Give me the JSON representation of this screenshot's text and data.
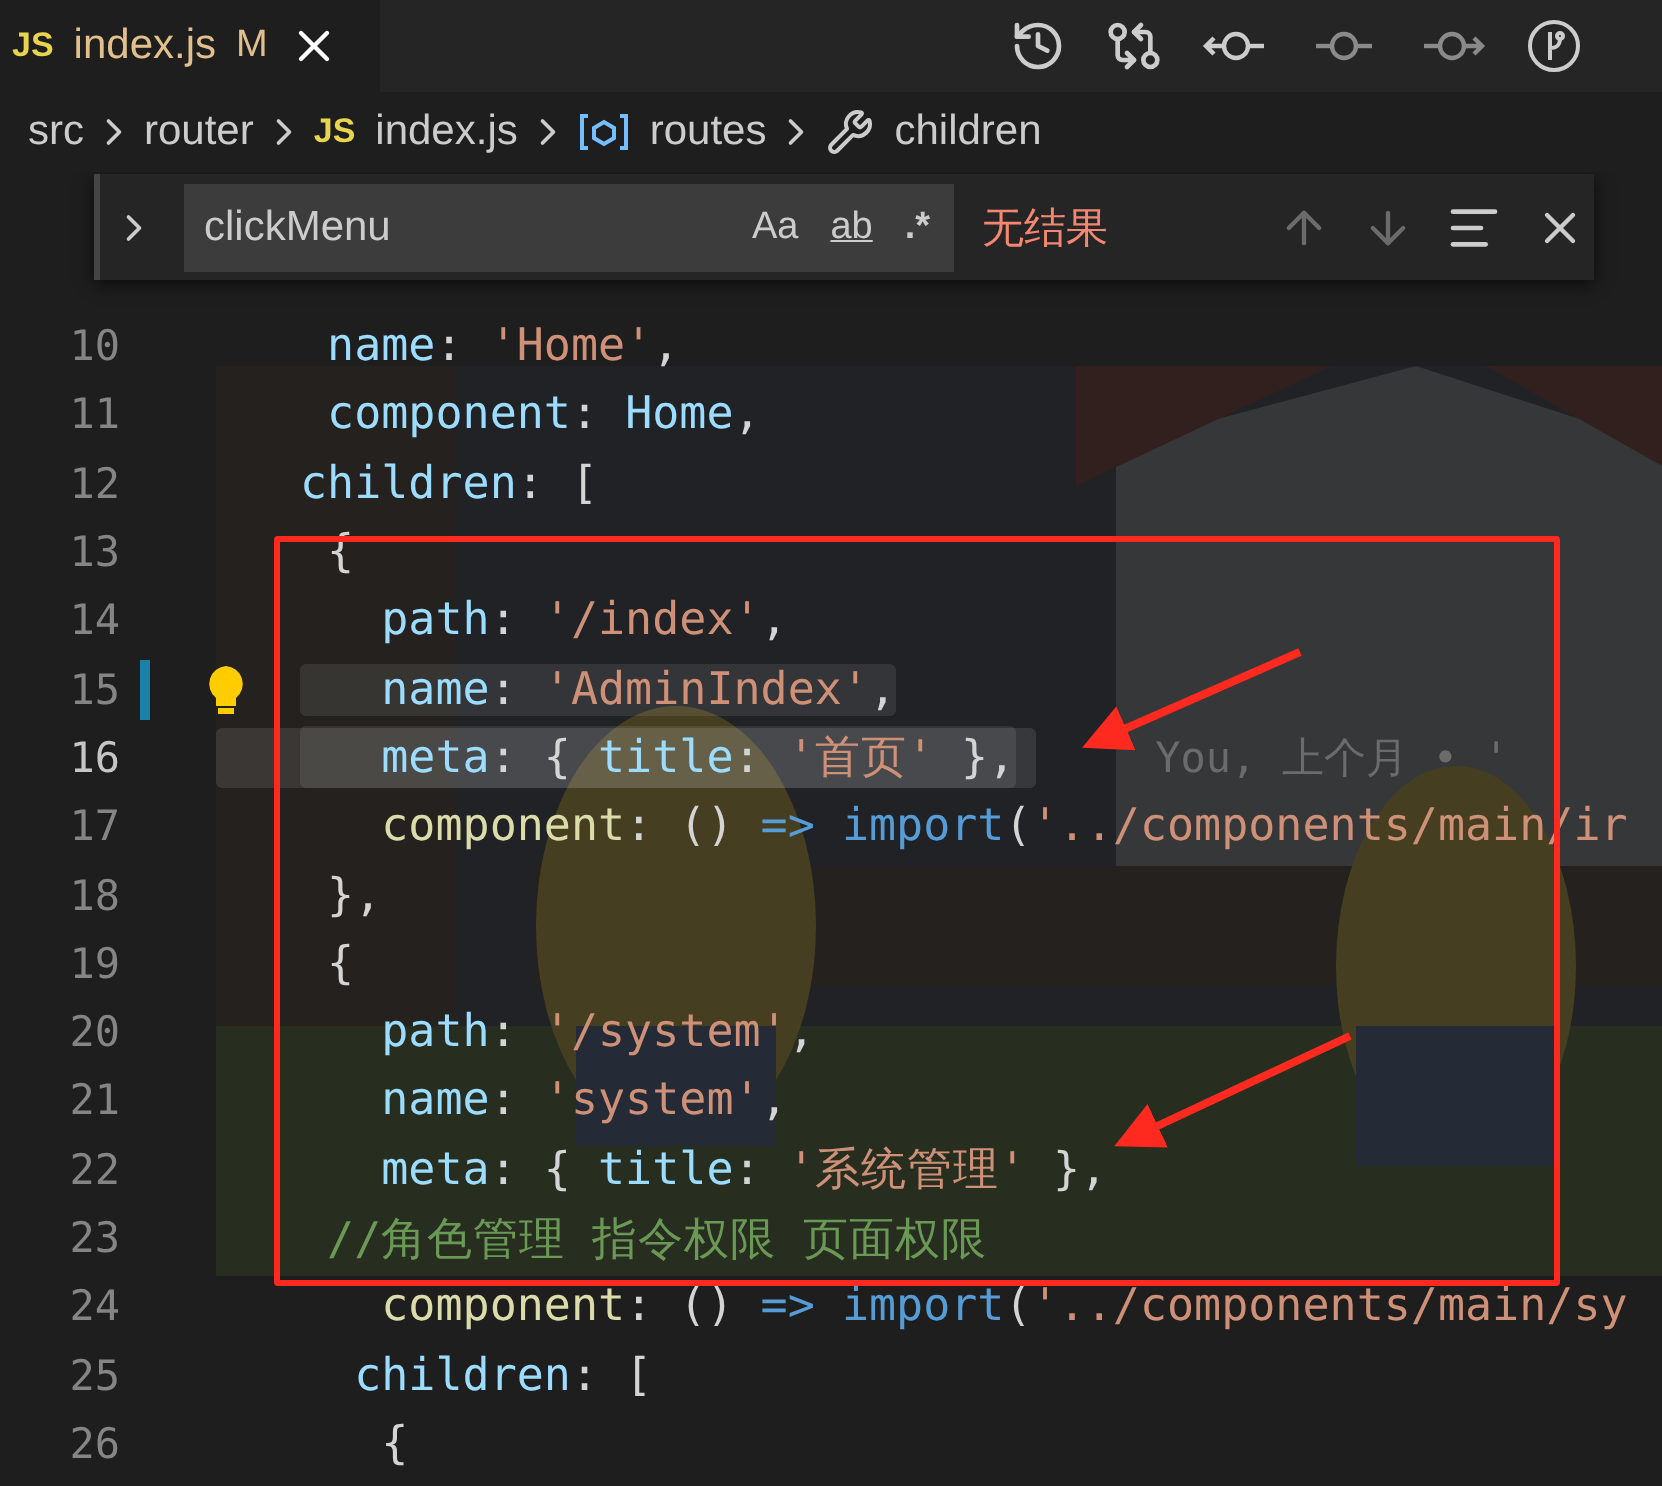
{
  "tabs": [
    {
      "icon_label": "JS",
      "name": "index.js",
      "status": "M",
      "selected": true
    }
  ],
  "breadcrumb": [
    {
      "label": "src",
      "kind": "folder"
    },
    {
      "label": "router",
      "kind": "folder"
    },
    {
      "label": "index.js",
      "kind": "file",
      "icon_label": "JS"
    },
    {
      "label": "routes",
      "kind": "symbol"
    },
    {
      "label": "children",
      "kind": "property"
    }
  ],
  "find": {
    "expanded": false,
    "value": "clickMenu",
    "options": [
      {
        "label": "Aa",
        "kind": "case"
      },
      {
        "label": "ab",
        "kind": "word"
      },
      {
        "label": ".*",
        "kind": "regex"
      }
    ],
    "status": "无结果",
    "nav": [
      {
        "kind": "previous",
        "disabled": true
      },
      {
        "kind": "next",
        "disabled": true
      }
    ]
  },
  "lines": [
    {
      "number": "10",
      "tokens": [
        {
          "kind": "prop",
          "text": " name"
        },
        {
          "kind": "punct",
          "text": ": "
        },
        {
          "kind": "str",
          "text": "'Home'"
        },
        {
          "kind": "punct",
          "text": ","
        }
      ]
    },
    {
      "number": "11",
      "tokens": [
        {
          "kind": "prop",
          "text": " component"
        },
        {
          "kind": "punct",
          "text": ": "
        },
        {
          "kind": "prop",
          "text": "Home"
        },
        {
          "kind": "punct",
          "text": ","
        }
      ]
    },
    {
      "number": "12",
      "tokens": [
        {
          "kind": "prop",
          "text": "children"
        },
        {
          "kind": "punct",
          "text": ": ["
        }
      ]
    },
    {
      "number": "13",
      "tokens": [
        {
          "kind": "punct",
          "text": " {"
        }
      ]
    },
    {
      "number": "14",
      "tokens": [
        {
          "kind": "prop",
          "text": "   path"
        },
        {
          "kind": "punct",
          "text": ": "
        },
        {
          "kind": "str",
          "text": "'/index'"
        },
        {
          "kind": "punct",
          "text": ","
        }
      ]
    },
    {
      "number": "15",
      "modified": true,
      "lightbulb": true,
      "highlighted": true,
      "tokens": [
        {
          "kind": "prop",
          "text": "   name"
        },
        {
          "kind": "punct",
          "text": ": "
        },
        {
          "kind": "str",
          "text": "'AdminIndex'"
        },
        {
          "kind": "punct",
          "text": ","
        }
      ]
    },
    {
      "number": "16",
      "current": true,
      "highlighted": true,
      "blame": "You, 上个月 • '",
      "tokens": [
        {
          "kind": "prop",
          "text": "   meta"
        },
        {
          "kind": "punct",
          "text": ": { "
        },
        {
          "kind": "prop",
          "text": "title"
        },
        {
          "kind": "punct",
          "text": ": "
        },
        {
          "kind": "str",
          "text": "'首页'"
        },
        {
          "kind": "punct",
          "text": " },"
        }
      ]
    },
    {
      "number": "17",
      "tokens": [
        {
          "kind": "func",
          "text": "   component"
        },
        {
          "kind": "punct",
          "text": ": () "
        },
        {
          "kind": "kw",
          "text": "=> "
        },
        {
          "kind": "kw",
          "text": "import"
        },
        {
          "kind": "punct",
          "text": "("
        },
        {
          "kind": "str",
          "text": "'../components/main/ir"
        }
      ]
    },
    {
      "number": "18",
      "tokens": [
        {
          "kind": "punct",
          "text": " },"
        }
      ]
    },
    {
      "number": "19",
      "tokens": [
        {
          "kind": "punct",
          "text": " {"
        }
      ]
    },
    {
      "number": "20",
      "tokens": [
        {
          "kind": "prop",
          "text": "   path"
        },
        {
          "kind": "punct",
          "text": ": "
        },
        {
          "kind": "str",
          "text": "'/system'"
        },
        {
          "kind": "punct",
          "text": ","
        }
      ]
    },
    {
      "number": "21",
      "tokens": [
        {
          "kind": "prop",
          "text": "   name"
        },
        {
          "kind": "punct",
          "text": ": "
        },
        {
          "kind": "str",
          "text": "'system'"
        },
        {
          "kind": "punct",
          "text": ","
        }
      ]
    },
    {
      "number": "22",
      "tokens": [
        {
          "kind": "prop",
          "text": "   meta"
        },
        {
          "kind": "punct",
          "text": ": { "
        },
        {
          "kind": "prop",
          "text": "title"
        },
        {
          "kind": "punct",
          "text": ": "
        },
        {
          "kind": "str",
          "text": "'系统管理'"
        },
        {
          "kind": "punct",
          "text": " },"
        }
      ]
    },
    {
      "number": "23",
      "tokens": [
        {
          "kind": "comment",
          "text": " //角色管理 指令权限 页面权限"
        }
      ]
    },
    {
      "number": "24",
      "tokens": [
        {
          "kind": "func",
          "text": "   component"
        },
        {
          "kind": "punct",
          "text": ": () "
        },
        {
          "kind": "kw",
          "text": "=> "
        },
        {
          "kind": "kw",
          "text": "import"
        },
        {
          "kind": "punct",
          "text": "("
        },
        {
          "kind": "str",
          "text": "'../components/main/sy"
        }
      ]
    },
    {
      "number": "25",
      "tokens": [
        {
          "kind": "prop",
          "text": "  children"
        },
        {
          "kind": "punct",
          "text": ": ["
        }
      ]
    },
    {
      "number": "26",
      "tokens": [
        {
          "kind": "punct",
          "text": "   {"
        }
      ]
    }
  ]
}
